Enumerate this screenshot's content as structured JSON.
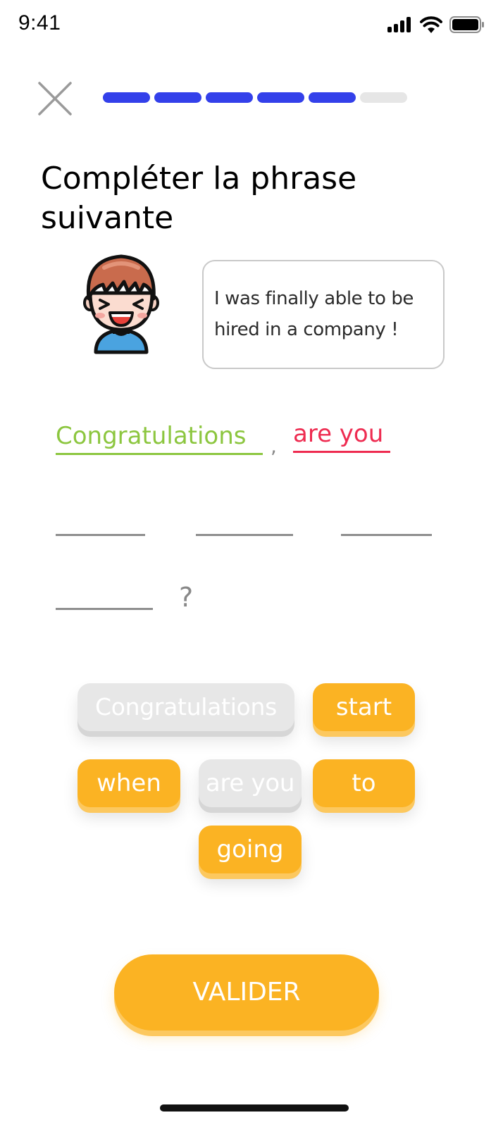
{
  "status_bar": {
    "time": "9:41",
    "icons": [
      "signal-icon",
      "wifi-icon",
      "battery-icon"
    ]
  },
  "header": {
    "close_icon": "close-icon",
    "progress": {
      "completed_segments": 5,
      "total_segments": 6
    }
  },
  "exercise": {
    "title": "Compléter la phrase suivante",
    "speech_bubble": "I was finally able to be hired in a company !",
    "answer": {
      "slots": [
        {
          "text": "Congratulations",
          "state": "correct"
        },
        {
          "text": "are you",
          "state": "incorrect"
        },
        {
          "text": "",
          "state": "empty"
        },
        {
          "text": "",
          "state": "empty"
        },
        {
          "text": "",
          "state": "empty"
        },
        {
          "text": "",
          "state": "empty"
        }
      ],
      "comma": ",",
      "question_mark": "?"
    },
    "word_bank": [
      {
        "label": "Congratulations",
        "used": true
      },
      {
        "label": "start",
        "used": false
      },
      {
        "label": "when",
        "used": false
      },
      {
        "label": "are you",
        "used": true
      },
      {
        "label": "to",
        "used": false
      },
      {
        "label": "going",
        "used": false
      }
    ]
  },
  "footer": {
    "validate_label": "VALIDER"
  },
  "colors": {
    "progress_done": "#3340ea",
    "progress_pending": "#e6e6e6",
    "accent_orange": "#fbb323",
    "correct_green": "#8cc63f",
    "incorrect_red": "#ee2b50",
    "chip_used_grey": "#e7e7e7"
  }
}
